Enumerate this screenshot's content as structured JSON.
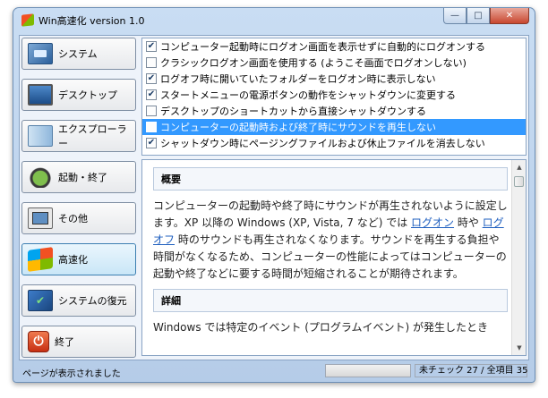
{
  "window": {
    "title": "Win高速化 version 1.0",
    "controls": {
      "minimize": "—",
      "maximize": "□",
      "close": "✕"
    }
  },
  "nav": {
    "items": [
      {
        "label": "システム",
        "icon": "system-icon"
      },
      {
        "label": "デスクトップ",
        "icon": "desktop-icon"
      },
      {
        "label": "エクスプローラー",
        "icon": "explorer-icon"
      },
      {
        "label": "起動・終了",
        "icon": "power-icon"
      },
      {
        "label": "その他",
        "icon": "other-icon"
      },
      {
        "label": "高速化",
        "icon": "windows-logo-icon",
        "active": true
      },
      {
        "label": "システムの復元",
        "icon": "restore-icon"
      },
      {
        "label": "終了",
        "icon": "exit-icon"
      }
    ]
  },
  "options": [
    {
      "label": "コンピューター起動時にログオン画面を表示せずに自動的にログオンする",
      "checked": true
    },
    {
      "label": "クラシックログオン画面を使用する (ようこそ画面でログオンしない)",
      "checked": false
    },
    {
      "label": "ログオフ時に開いていたフォルダーをログオン時に表示しない",
      "checked": true
    },
    {
      "label": "スタートメニューの電源ボタンの動作をシャットダウンに変更する",
      "checked": true
    },
    {
      "label": "デスクトップのショートカットから直接シャットダウンする",
      "checked": false
    },
    {
      "label": "コンピューターの起動時および終了時にサウンドを再生しない",
      "checked": false,
      "selected": true
    },
    {
      "label": "シャットダウン時にページングファイルおよび休止ファイルを消去しない",
      "checked": true
    }
  ],
  "description": {
    "overview_heading": "概要",
    "overview_parts": [
      "コンピューターの起動時や終了時にサウンドが再生されないように設定します。XP 以降の Windows (XP, Vista, 7 など) では ",
      "ログオン",
      " 時や ",
      "ログオフ",
      " 時のサウンドも再生されなくなります。サウンドを再生する負担や時間がなくなるため、コンピューターの性能によってはコンピューターの起動や終了などに要する時間が短縮されることが期待されます。"
    ],
    "detail_heading": "詳細",
    "detail_text": "Windows では特定のイベント (プログラムイベント) が発生したとき"
  },
  "status": {
    "message": "ページが表示されました",
    "count": "未チェック 27 / 全項目 35"
  },
  "colors": {
    "selection": "#3399ff",
    "link": "#1f5fbf",
    "frame": "#b5cce8"
  }
}
